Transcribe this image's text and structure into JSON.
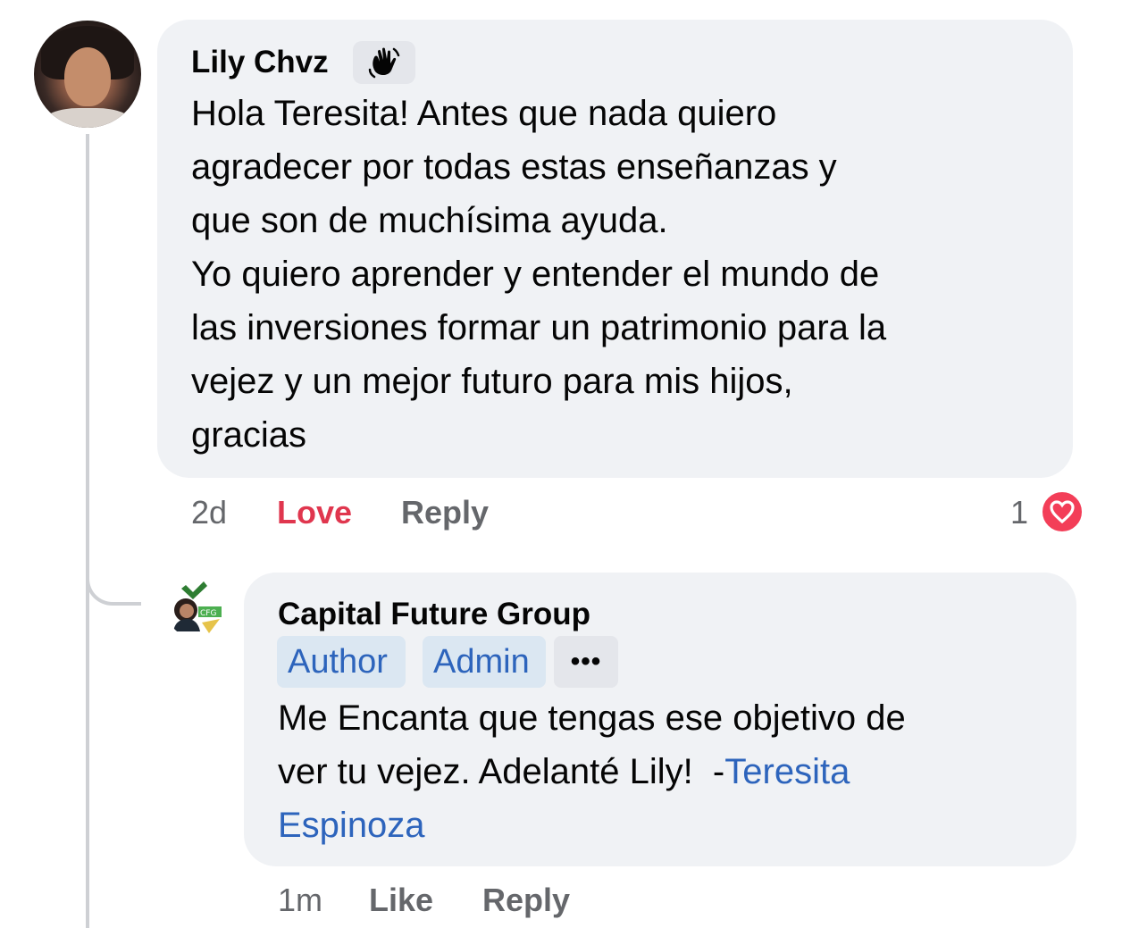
{
  "thread": {
    "comment": {
      "author": "Lily Chvz",
      "badge_icon": "waving-hand-icon",
      "text": "Hola Teresita! Antes que nada quiero\nagradecer por todas estas enseñanzas y\nque son de muchísima ayuda.\nYo quiero aprender y entender el mundo de\nlas inversiones formar un patrimonio para la\nvejez y un mejor futuro para mis hijos,\ngracias",
      "actions": {
        "time": "2d",
        "love": "Love",
        "reply": "Reply"
      },
      "reactions": {
        "count": "1",
        "icon": "heart-icon",
        "color": "#f33e58"
      }
    },
    "reply": {
      "author": "Capital Future Group",
      "chips": {
        "author": "Author",
        "admin": "Admin",
        "more": "•••"
      },
      "text_before": "Me Encanta que tengas ese objetivo de\nver tu vejez. Adelanté Lily!  -",
      "mention": "Teresita\nEspinoza",
      "actions": {
        "time": "1m",
        "like": "Like",
        "reply": "Reply"
      }
    }
  },
  "colors": {
    "bubble": "#f0f2f5",
    "link": "#2d64bc",
    "love": "#e0364e",
    "meta": "#65676b",
    "thread_line": "#ced0d4"
  }
}
